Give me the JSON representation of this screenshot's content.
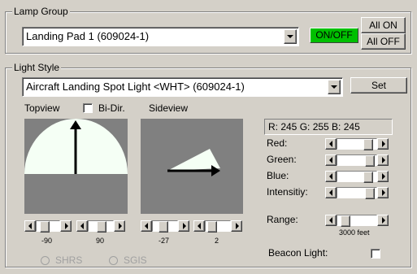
{
  "lamp_group": {
    "legend": "Lamp Group",
    "selected": "Landing Pad 1 (609024-1)",
    "on_off_label": "ON/OFF",
    "on_off_color": "#00c000",
    "all_on_label": "All ON",
    "all_off_label": "All OFF"
  },
  "light_style": {
    "legend": "Light Style",
    "selected": "Aircraft Landing Spot Light <WHT> (609024-1)",
    "set_label": "Set",
    "topview_label": "Topview",
    "bidir_label": "Bi-Dir.",
    "bidir_checked": false,
    "sideview_label": "Sideview",
    "top_min_label": "-90",
    "top_max_label": "90",
    "side_min_label": "-27",
    "side_max_label": "2",
    "rgb_readout": "R: 245 G: 255 B: 245",
    "red_label": "Red:",
    "green_label": "Green:",
    "blue_label": "Blue:",
    "intensity_label": "Intensitiy:",
    "range_label": "Range:",
    "range_value": "3000 feet",
    "beacon_label": "Beacon Light:",
    "beacon_checked": false,
    "shrs_label": "SHRS",
    "sgis_label": "SGIS",
    "light_color": "#f5fff5",
    "panel_color": "#808080"
  }
}
